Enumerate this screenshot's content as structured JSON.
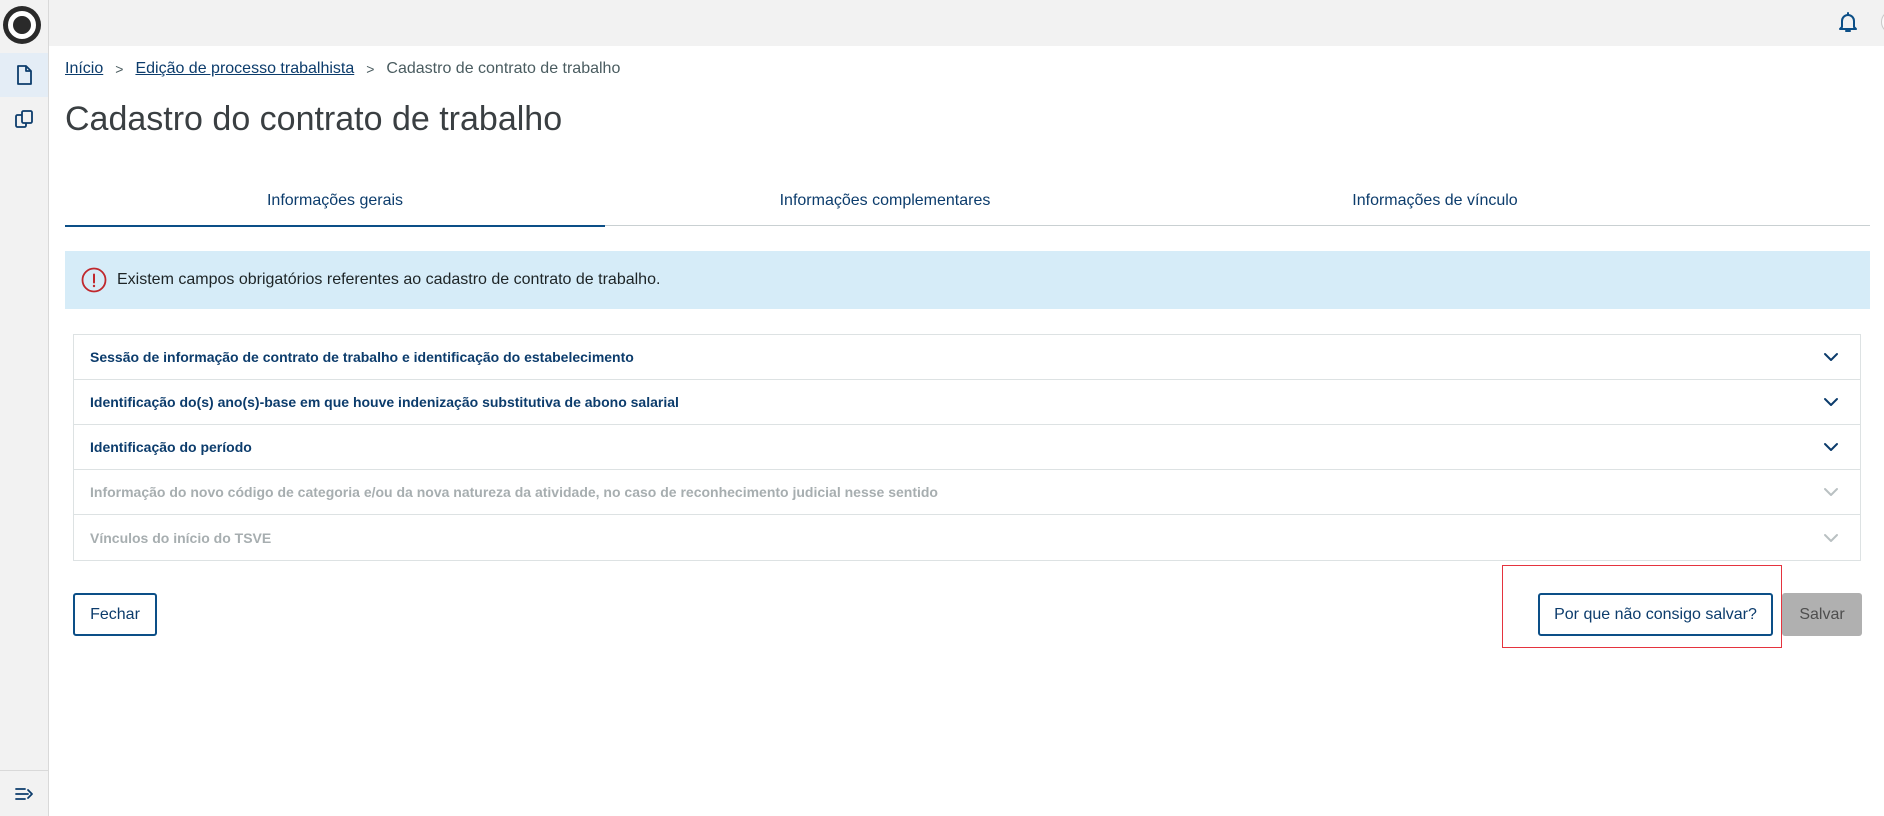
{
  "breadcrumb": {
    "home": "Início",
    "parent": "Edição de processo trabalhista",
    "current": "Cadastro de contrato de trabalho",
    "separator": ">"
  },
  "page": {
    "title": "Cadastro do contrato de trabalho"
  },
  "tabs": [
    {
      "label": "Informações gerais",
      "active": true
    },
    {
      "label": "Informações complementares",
      "active": false
    },
    {
      "label": "Informações de vínculo",
      "active": false
    }
  ],
  "alert": {
    "text": "Existem campos obrigatórios referentes ao cadastro de contrato de trabalho."
  },
  "sections": [
    {
      "label": "Sessão de informação de contrato de trabalho e identificação do estabelecimento",
      "enabled": true
    },
    {
      "label": "Identificação do(s) ano(s)-base em que houve indenização substitutiva de abono salarial",
      "enabled": true
    },
    {
      "label": "Identificação do período",
      "enabled": true
    },
    {
      "label": "Informação do novo código de categoria e/ou da nova natureza da atividade, no caso de reconhecimento judicial nesse sentido",
      "enabled": false
    },
    {
      "label": "Vínculos do início do TSVE",
      "enabled": false
    }
  ],
  "actions": {
    "close_label": "Fechar",
    "why_label": "Por que não consigo salvar?",
    "save_label": "Salvar"
  },
  "colors": {
    "primary": "#0c4f87",
    "link": "#0c3c6c",
    "alert_bg": "#d6ecf8",
    "alert_icon": "#c0282d",
    "disabled_text": "#a7aeb0",
    "highlight": "#e5333e"
  },
  "icons": {
    "logo": "brand-logo",
    "nav1": "document-icon",
    "nav2": "copy-icon",
    "collapse": "collapse-menu-icon",
    "bell": "bell-icon",
    "avatar": "user-icon",
    "alert": "info-icon",
    "chevron": "chevron-down-icon"
  }
}
